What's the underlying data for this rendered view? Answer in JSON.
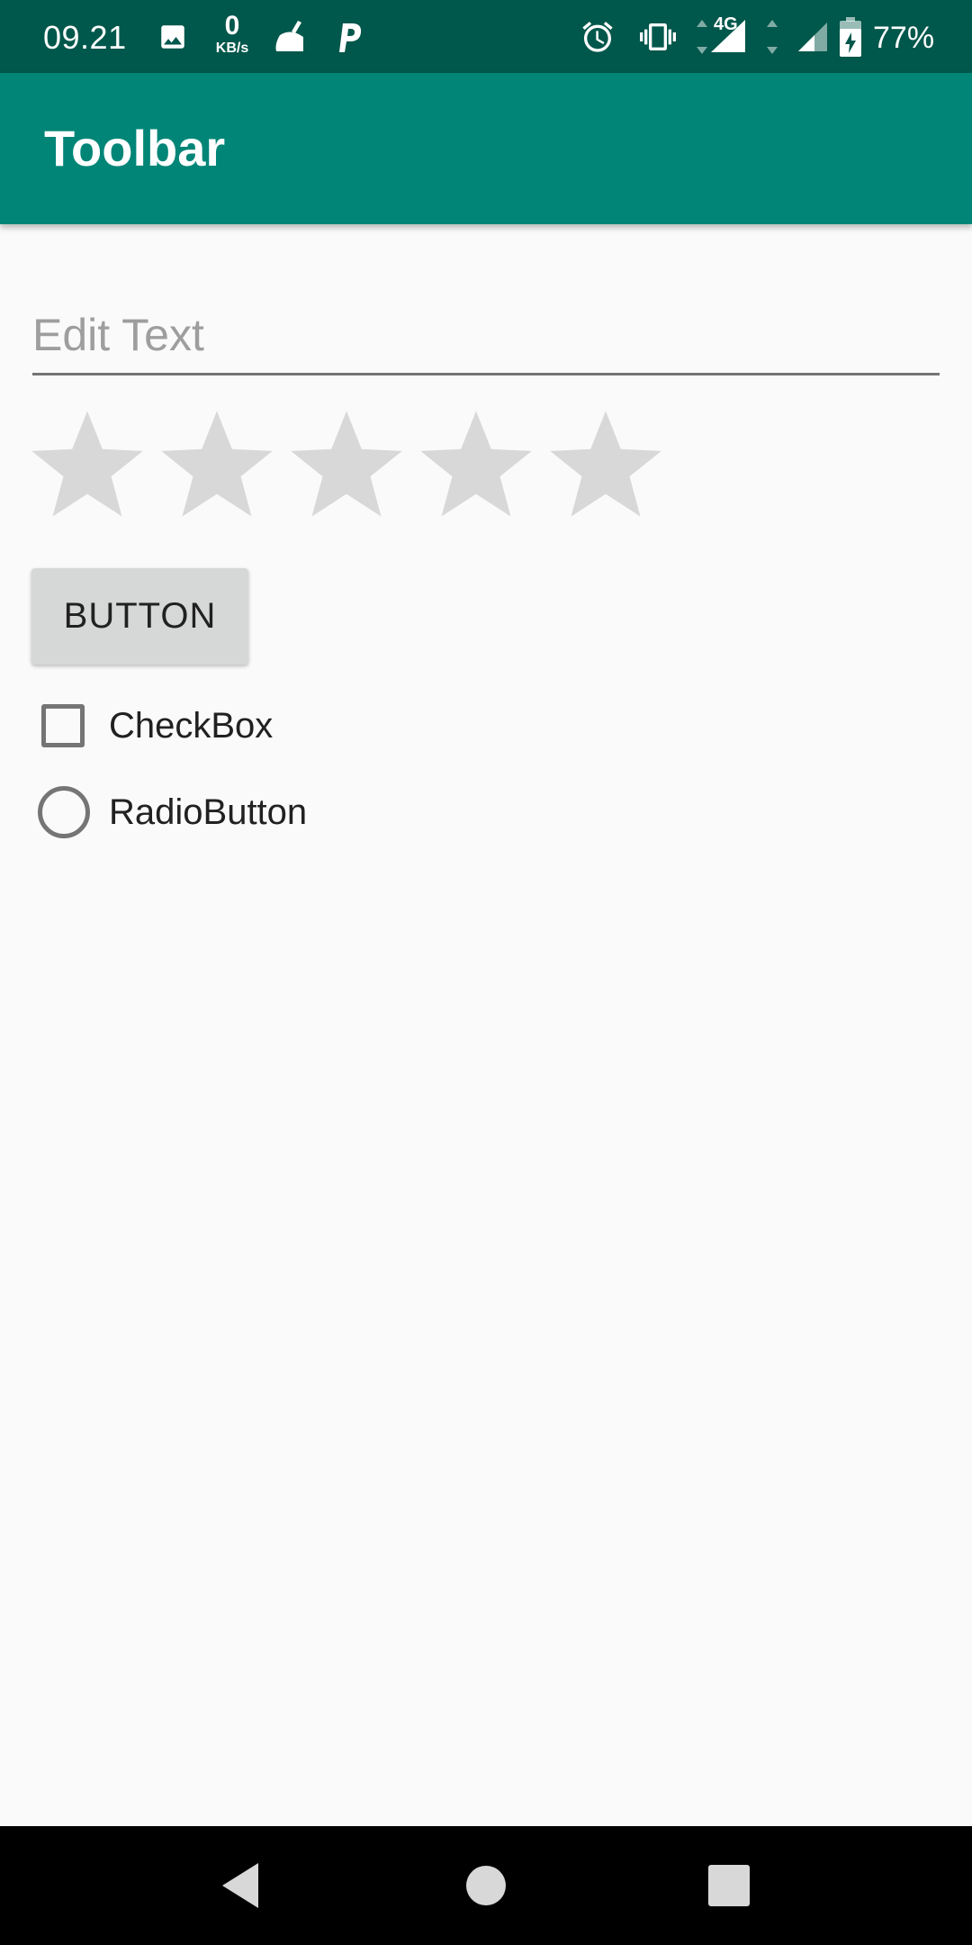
{
  "status_bar": {
    "time": "09.21",
    "data_speed_value": "0",
    "data_speed_unit": "KB/s",
    "network_type": "4G",
    "battery_percent": "77%",
    "background_color": "#00574b",
    "icons": [
      "image-icon",
      "data-speed-icon",
      "cleaner-icon",
      "parking-app-icon",
      "alarm-icon",
      "vibrate-icon",
      "signal-4g-icon",
      "signal-icon",
      "battery-charging-icon"
    ]
  },
  "toolbar": {
    "title": "Toolbar",
    "background_color": "#008577"
  },
  "content": {
    "edit_text": {
      "placeholder": "Edit Text",
      "value": ""
    },
    "rating_bar": {
      "num_stars": 5,
      "rating": 0,
      "star_color": "#d8d8d8"
    },
    "button": {
      "label": "BUTTON"
    },
    "checkbox": {
      "label": "CheckBox",
      "checked": false
    },
    "radio_button": {
      "label": "RadioButton",
      "checked": false
    }
  },
  "nav_bar": {
    "items": [
      "back-icon",
      "home-icon",
      "recents-icon"
    ]
  }
}
